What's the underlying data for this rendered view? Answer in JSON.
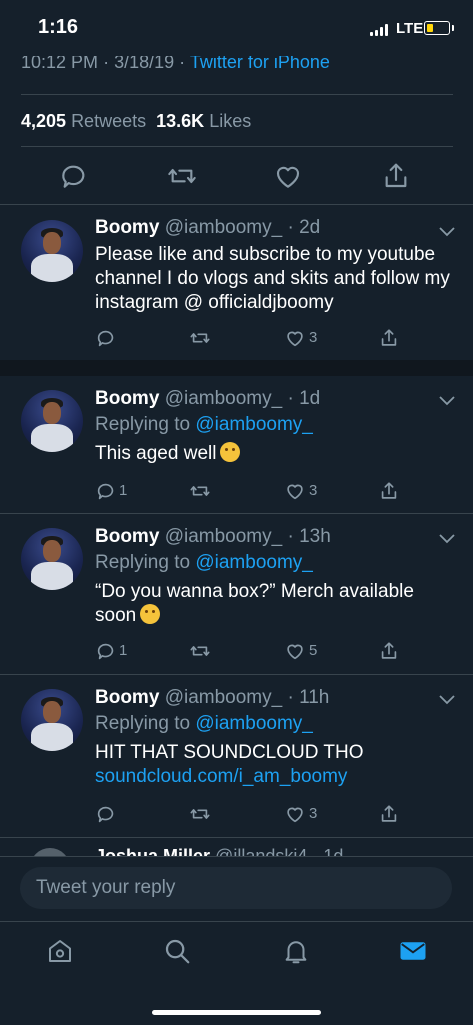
{
  "status_bar": {
    "time": "1:16",
    "network": "LTE",
    "battery_level": 0.25,
    "battery_color": "#ffd60a"
  },
  "tweet_meta": {
    "time": "10:12 PM",
    "date": "3/18/19",
    "source": "Twitter for iPhone"
  },
  "stats": {
    "retweets_count": "4,205",
    "retweets_label": "Retweets",
    "likes_count": "13.6K",
    "likes_label": "Likes"
  },
  "main_actions": [
    "reply-icon",
    "retweet-icon",
    "like-icon",
    "share-icon"
  ],
  "replies": [
    {
      "name": "Boomy",
      "handle": "@iamboomy_",
      "time": "2d",
      "text": "Please like and subscribe to my youtube channel I do vlogs and skits and follow my instagram @ officialdjboomy",
      "reply_count": "",
      "retweet_count": "",
      "like_count": "3"
    },
    {
      "name": "Boomy",
      "handle": "@iamboomy_",
      "time": "1d",
      "replying_prefix": "Replying to",
      "replying_to": "@iamboomy_",
      "text": "This aged well",
      "reply_count": "1",
      "retweet_count": "",
      "like_count": "3"
    },
    {
      "name": "Boomy",
      "handle": "@iamboomy_",
      "time": "13h",
      "replying_prefix": "Replying to",
      "replying_to": "@iamboomy_",
      "text": "“Do you wanna box?” Merch available soon",
      "reply_count": "1",
      "retweet_count": "",
      "like_count": "5"
    },
    {
      "name": "Boomy",
      "handle": "@iamboomy_",
      "time": "11h",
      "replying_prefix": "Replying to",
      "replying_to": "@iamboomy_",
      "text": "HIT THAT SOUNDCLOUD THO",
      "link": "soundcloud.com/i_am_boomy",
      "reply_count": "",
      "retweet_count": "",
      "like_count": "3"
    }
  ],
  "partial_reply": {
    "name": "Joshua Miller",
    "handle": "@illandski4",
    "time": "1d"
  },
  "compose": {
    "placeholder": "Tweet your reply"
  },
  "tabs": [
    "home-icon",
    "search-icon",
    "notifications-icon",
    "messages-icon"
  ],
  "colors": {
    "background": "#15202b",
    "accent": "#1da1f2",
    "muted": "#8899a6",
    "divider": "#38444d"
  }
}
